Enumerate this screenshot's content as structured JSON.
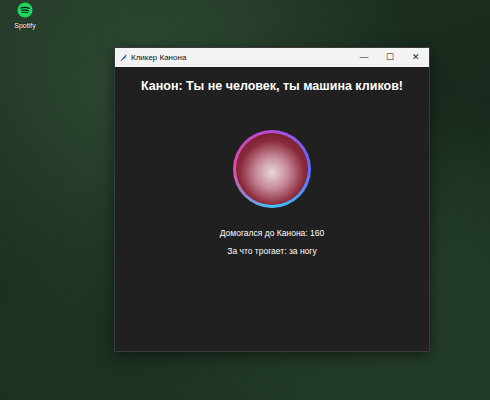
{
  "desktop": {
    "icons": [
      {
        "label": "Spotify"
      }
    ]
  },
  "window": {
    "title": "Кликер Канона",
    "controls": [
      "—",
      "☐",
      "✕"
    ]
  },
  "heading": "Канон: Ты не человек, ты машина кликов!",
  "counter": "Домогался до Канона: 160",
  "reason": "За что трогает: за ногу"
}
